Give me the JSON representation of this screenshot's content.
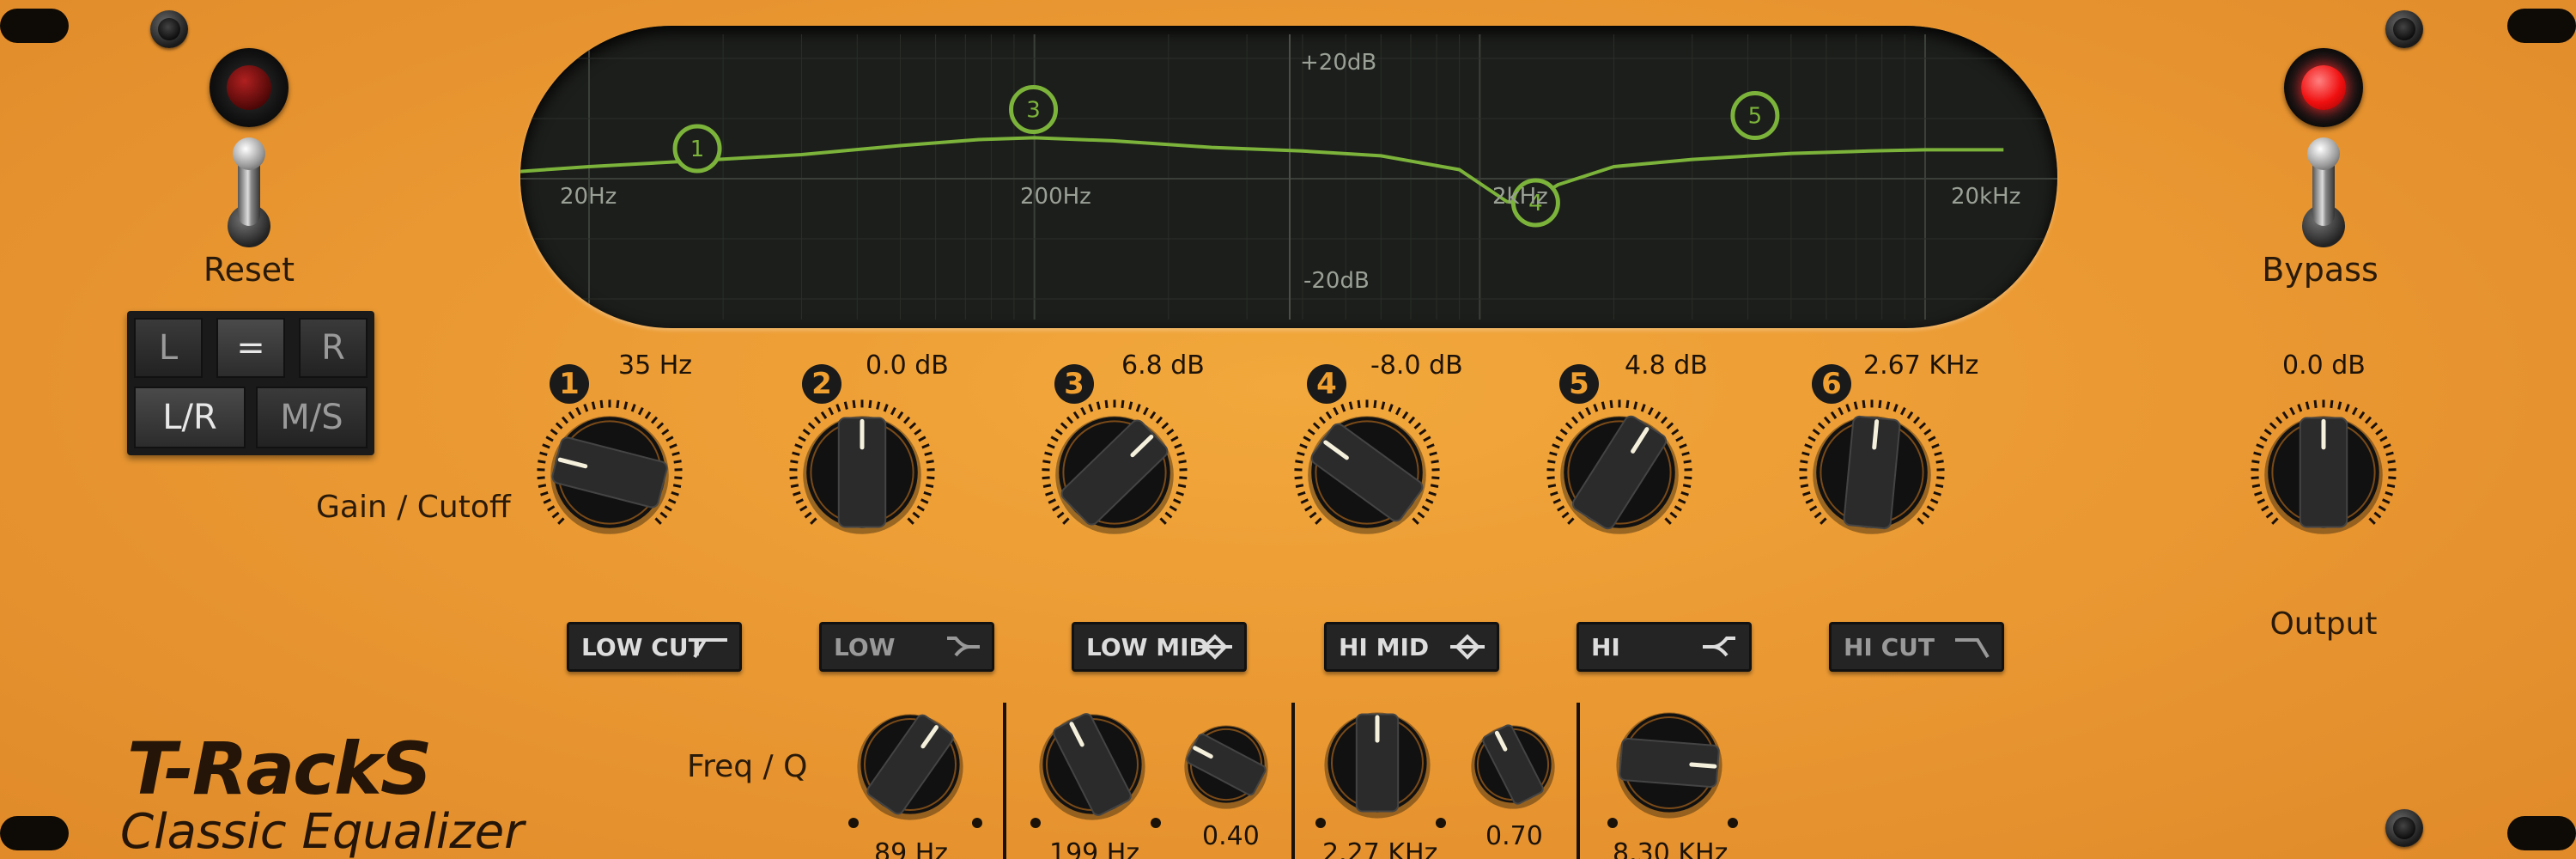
{
  "plugin": {
    "brand": "T-RackS",
    "product": "Classic Equalizer"
  },
  "controls": {
    "reset_label": "Reset",
    "bypass_label": "Bypass",
    "output_label": "Output",
    "output_value": "0.0 dB",
    "output_level": 0.5,
    "gain_cutoff_label": "Gain / Cutoff",
    "freq_q_label": "Freq / Q",
    "reset_led": "off",
    "bypass_led": "on"
  },
  "mode_buttons": [
    {
      "label": "L",
      "active": false
    },
    {
      "label": "=",
      "active": true
    },
    {
      "label": "R",
      "active": false
    },
    {
      "label": "L/R",
      "active": true
    },
    {
      "label": "M/S",
      "active": false
    }
  ],
  "bands": [
    {
      "number": "1",
      "value": "35 Hz",
      "button": "LOW CUT",
      "icon": "low-cut-icon",
      "enabled": true,
      "level": 0.22
    },
    {
      "number": "2",
      "value": "0.0 dB",
      "button": "LOW",
      "icon": "low-shelf-icon",
      "enabled": false,
      "level": 0.5
    },
    {
      "number": "3",
      "value": "6.8 dB",
      "button": "LOW MID",
      "icon": "bell-icon",
      "enabled": true,
      "level": 0.67
    },
    {
      "number": "4",
      "value": "-8.0 dB",
      "button": "HI MID",
      "icon": "bell-icon",
      "enabled": true,
      "level": 0.3
    },
    {
      "number": "5",
      "value": "4.8 dB",
      "button": "HI",
      "icon": "high-shelf-icon",
      "enabled": true,
      "level": 0.62
    },
    {
      "number": "6",
      "value": "2.67 KHz",
      "button": "HI CUT",
      "icon": "high-cut-icon",
      "enabled": false,
      "level": 0.52
    }
  ],
  "freq_q": [
    {
      "value": "89 Hz",
      "level": 0.63
    },
    {
      "value": "199 Hz",
      "level": 0.4
    },
    {
      "value": "0.40",
      "level": 0.27
    },
    {
      "value": "2.27 KHz",
      "level": 0.5
    },
    {
      "value": "0.70",
      "level": 0.4
    },
    {
      "value": "8.30 KHz",
      "level": 0.85
    }
  ],
  "display": {
    "labels": {
      "top": "+20dB",
      "bottom": "-20dB",
      "f1": "20Hz",
      "f2": "200Hz",
      "f3": "2kHz",
      "f4": "20kHz"
    },
    "accent": "#7cb33a",
    "chart_data": {
      "type": "line",
      "xscale": "log",
      "xlabel": "",
      "ylabel": "",
      "xticks": [
        "20Hz",
        "200Hz",
        "2kHz",
        "20kHz"
      ],
      "yticks": [
        "+20dB",
        "-20dB"
      ],
      "ylim": [
        -20,
        20
      ],
      "series": [
        {
          "x": [
            14,
            20,
            35,
            60,
            100,
            150,
            200,
            300,
            500,
            800,
            1200,
            1800,
            2300,
            2500,
            2700,
            3000,
            4000,
            6000,
            10000,
            15000,
            20000,
            30000
          ],
          "y": [
            1.2,
            2.0,
            3.0,
            4.0,
            5.5,
            6.5,
            6.8,
            6.3,
            5.2,
            4.6,
            3.8,
            1.5,
            -3.8,
            -4.2,
            -3.0,
            -1.0,
            2.0,
            3.2,
            4.2,
            4.6,
            4.8,
            4.8
          ]
        }
      ],
      "nodes": [
        {
          "label": "1",
          "x": 35,
          "y": 5.0
        },
        {
          "label": "3",
          "x": 199,
          "y": 11.5
        },
        {
          "label": "4",
          "x": 2670,
          "y": -4.0
        },
        {
          "label": "5",
          "x": 8300,
          "y": 10.5
        }
      ]
    }
  }
}
